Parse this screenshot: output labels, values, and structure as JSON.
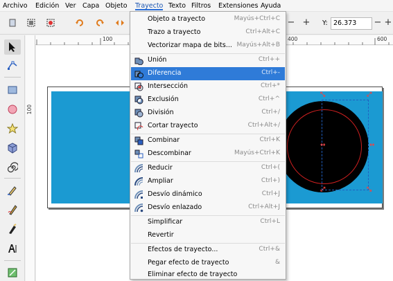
{
  "menubar": {
    "items": [
      "Archivo",
      "Edición",
      "Ver",
      "Capa",
      "Objeto",
      "Trayecto",
      "Texto",
      "Filtros",
      "Extensiones",
      "Ayuda"
    ],
    "active": "Trayecto"
  },
  "toolbar": {
    "x_value": "",
    "y_label": "Y:",
    "y_value": "26.373",
    "spin_minus": "−",
    "spin_plus": "+"
  },
  "rulers": {
    "h_numbers": [
      "100",
      "400",
      "600"
    ],
    "v_numbers": [
      "100"
    ]
  },
  "dropdown": {
    "items": [
      {
        "label": "Objeto a trayecto",
        "shortcut": "Mayús+Ctrl+C",
        "icon": ""
      },
      {
        "label": "Trazo a trayecto",
        "shortcut": "Ctrl+Alt+C",
        "icon": ""
      },
      {
        "label": "Vectorizar mapa de bits...",
        "shortcut": "Mayús+Alt+B",
        "icon": ""
      },
      {
        "label": "Unión",
        "shortcut": "Ctrl++",
        "icon": "union-icon"
      },
      {
        "label": "Diferencia",
        "shortcut": "Ctrl+-",
        "icon": "difference-icon"
      },
      {
        "label": "Intersección",
        "shortcut": "Ctrl+*",
        "icon": "intersection-icon"
      },
      {
        "label": "Exclusión",
        "shortcut": "Ctrl+^",
        "icon": "exclusion-icon"
      },
      {
        "label": "División",
        "shortcut": "Ctrl+/",
        "icon": "division-icon"
      },
      {
        "label": "Cortar trayecto",
        "shortcut": "Ctrl+Alt+/",
        "icon": "cut-path-icon"
      },
      {
        "label": "Combinar",
        "shortcut": "Ctrl+K",
        "icon": "combine-icon"
      },
      {
        "label": "Descombinar",
        "shortcut": "Mayús+Ctrl+K",
        "icon": "break-apart-icon"
      },
      {
        "label": "Reducir",
        "shortcut": "Ctrl+(",
        "icon": "inset-icon"
      },
      {
        "label": "Ampliar",
        "shortcut": "Ctrl+)",
        "icon": "outset-icon"
      },
      {
        "label": "Desvío dinámico",
        "shortcut": "Ctrl+J",
        "icon": "dynamic-offset-icon"
      },
      {
        "label": "Desvío enlazado",
        "shortcut": "Ctrl+Alt+J",
        "icon": "linked-offset-icon"
      },
      {
        "label": "Simplificar",
        "shortcut": "Ctrl+L",
        "icon": ""
      },
      {
        "label": "Revertir",
        "shortcut": "",
        "icon": ""
      },
      {
        "label": "Efectos de trayecto...",
        "shortcut": "Ctrl+&",
        "icon": ""
      },
      {
        "label": "Pegar efecto de trayecto",
        "shortcut": "&",
        "icon": ""
      },
      {
        "label": "Eliminar efecto de trayecto",
        "shortcut": "",
        "icon": ""
      }
    ],
    "hover_label": "Diferencia"
  },
  "colors": {
    "accent": "#2f7bd8",
    "canvas_rect": "#1b9ad2",
    "circle": "#000000",
    "handle": "#e44444"
  }
}
